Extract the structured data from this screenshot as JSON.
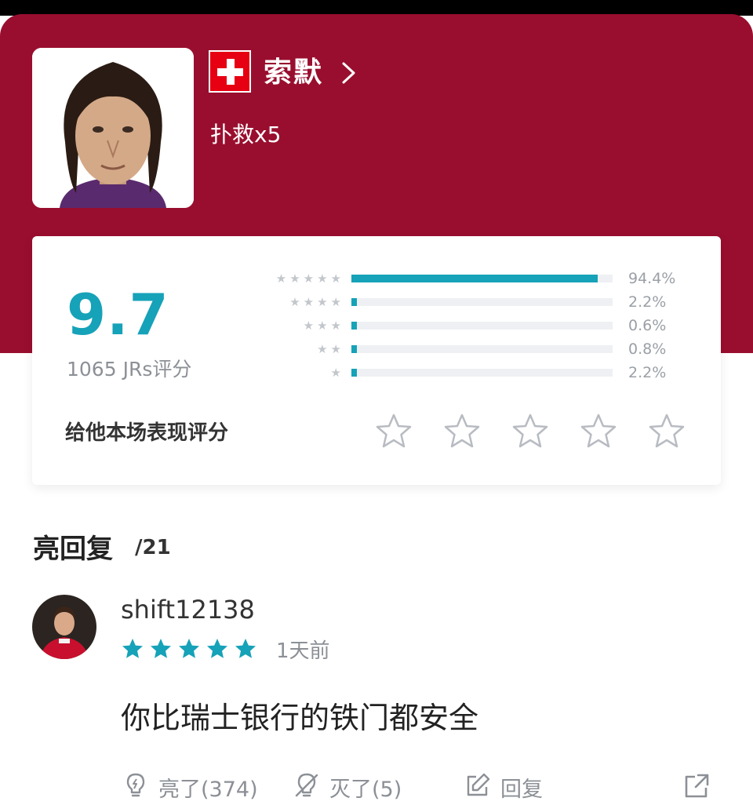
{
  "player": {
    "name": "索默",
    "stat": "扑救x5",
    "flag_icon": "swiss-flag-icon"
  },
  "rating": {
    "score": "9.7",
    "count_text": "1065 JRs评分",
    "distribution": [
      {
        "stars": 5,
        "percent_text": "94.4%",
        "percent": 94.4
      },
      {
        "stars": 4,
        "percent_text": "2.2%",
        "percent": 2.2
      },
      {
        "stars": 3,
        "percent_text": "0.6%",
        "percent": 0.6
      },
      {
        "stars": 2,
        "percent_text": "0.8%",
        "percent": 0.8
      },
      {
        "stars": 1,
        "percent_text": "2.2%",
        "percent": 2.2
      }
    ],
    "rate_prompt": "给他本场表现评分",
    "user_rating": 0,
    "max_rating": 5
  },
  "comments_section": {
    "title": "亮回复",
    "count": "/21"
  },
  "comment": {
    "username": "shift12138",
    "star_rating": 5,
    "time": "1天前",
    "text": "你比瑞士银行的铁门都安全",
    "actions": {
      "like_label": "亮了(374)",
      "dislike_label": "灭了(5)",
      "reply_label": "回复"
    }
  },
  "colors": {
    "brand": "#990e2e",
    "accent": "#16a2b8",
    "muted": "#8c9096"
  }
}
